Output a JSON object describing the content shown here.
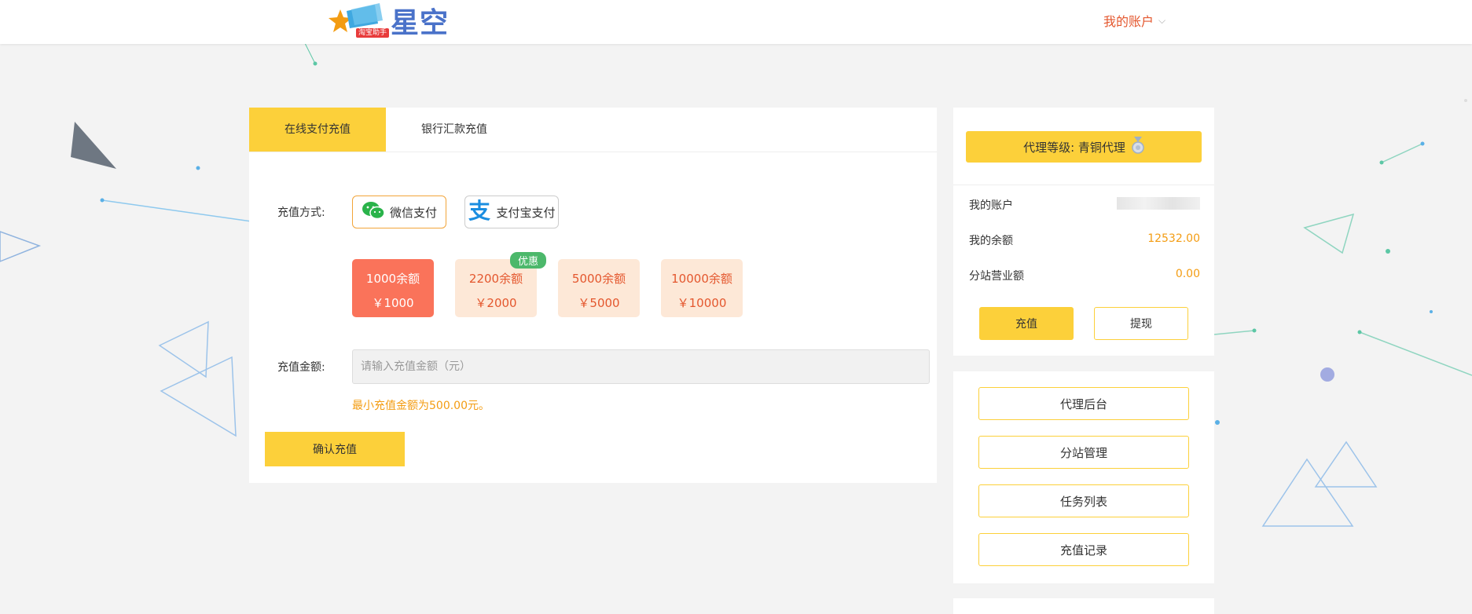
{
  "header": {
    "logo_text": "星空",
    "logo_badge": "淘宝助手",
    "account_menu_label": "我的账户"
  },
  "recharge": {
    "tabs": [
      {
        "label": "在线支付充值",
        "active": true
      },
      {
        "label": "银行汇款充值",
        "active": false
      }
    ],
    "method_label": "充值方式:",
    "methods": [
      {
        "label": "微信支付",
        "icon": "wechat-icon",
        "selected": true
      },
      {
        "label": "支付宝支付",
        "icon": "alipay-icon",
        "selected": false
      }
    ],
    "packages": [
      {
        "balance": "1000余额",
        "price": "￥1000",
        "selected": true,
        "badge": ""
      },
      {
        "balance": "2200余额",
        "price": "￥2000",
        "selected": false,
        "badge": "优惠"
      },
      {
        "balance": "5000余额",
        "price": "￥5000",
        "selected": false,
        "badge": ""
      },
      {
        "balance": "10000余额",
        "price": "￥10000",
        "selected": false,
        "badge": ""
      }
    ],
    "amount_label": "充值金额:",
    "amount_placeholder": "请输入充值金额（元）",
    "amount_value": "",
    "min_hint": "最小充值金额为500.00元。",
    "confirm_label": "确认充值"
  },
  "sidebar": {
    "level_text": "代理等级: 青铜代理",
    "level_icon": "bronze-medal-icon",
    "rows": [
      {
        "label": "我的账户",
        "value": ""
      },
      {
        "label": "我的余额",
        "value": "12532.00"
      },
      {
        "label": "分站营业额",
        "value": "0.00"
      }
    ],
    "recharge_label": "充值",
    "withdraw_label": "提现",
    "menu": [
      "代理后台",
      "分站管理",
      "任务列表",
      "充值记录"
    ]
  },
  "colors": {
    "accent_yellow": "#fcd03a",
    "highlight_orange": "#e4572e",
    "value_orange": "#f39c12",
    "selected_package": "#fa735a",
    "package_bg": "#fde8d7",
    "promo_green": "#4cb86b"
  }
}
